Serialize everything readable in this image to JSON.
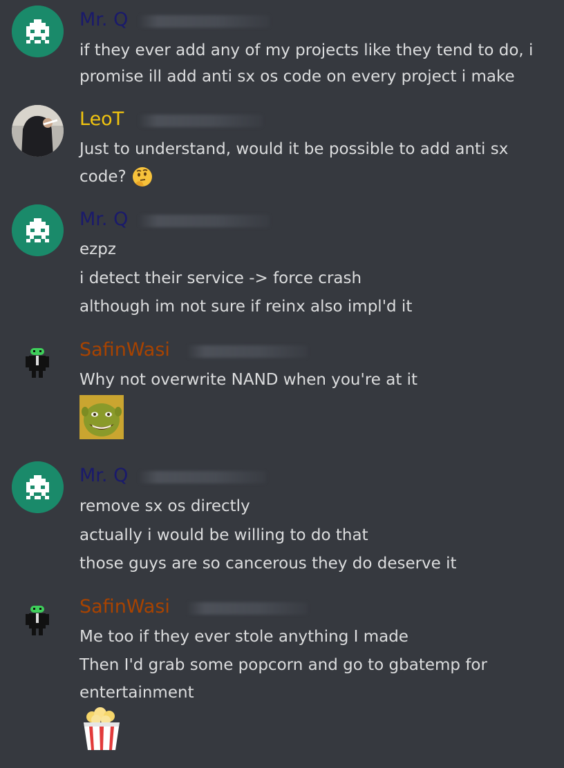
{
  "colors": {
    "background": "#36393f",
    "text": "#dcddde",
    "name_mrq": "#1a1a6b",
    "name_leot": "#f1c40f",
    "name_safin": "#a84300"
  },
  "messages": [
    {
      "author": "Mr. Q",
      "avatar_icon": "space-invader-avatar",
      "lines": [
        "if they ever add any of my projects like they tend to do, i",
        "promise ill add anti sx os code on every project i make"
      ]
    },
    {
      "author": "LeoT",
      "avatar_icon": "photo-avatar",
      "lines": [
        "Just to understand, would it be possible to add anti sx",
        "code?"
      ],
      "emoji": "thinking-face-emoji"
    },
    {
      "author": "Mr. Q",
      "avatar_icon": "space-invader-avatar",
      "lines": [
        "ezpz",
        "i detect their service -> force crash",
        "although im not sure if reinx also impl'd it"
      ]
    },
    {
      "author": "SafinWasi",
      "avatar_icon": "android-robot-avatar",
      "lines": [
        "Why not overwrite NAND when you're at it"
      ],
      "attachment": "shrek-emoji"
    },
    {
      "author": "Mr. Q",
      "avatar_icon": "space-invader-avatar",
      "lines": [
        "remove sx os directly",
        "actually i would be willing to do that",
        "those guys are so cancerous they do deserve it"
      ]
    },
    {
      "author": "SafinWasi",
      "avatar_icon": "android-robot-avatar",
      "lines": [
        "Me too if they ever stole anything I made",
        "Then I'd grab some popcorn and go to gbatemp for",
        "entertainment"
      ],
      "attachment": "popcorn-emoji"
    }
  ]
}
